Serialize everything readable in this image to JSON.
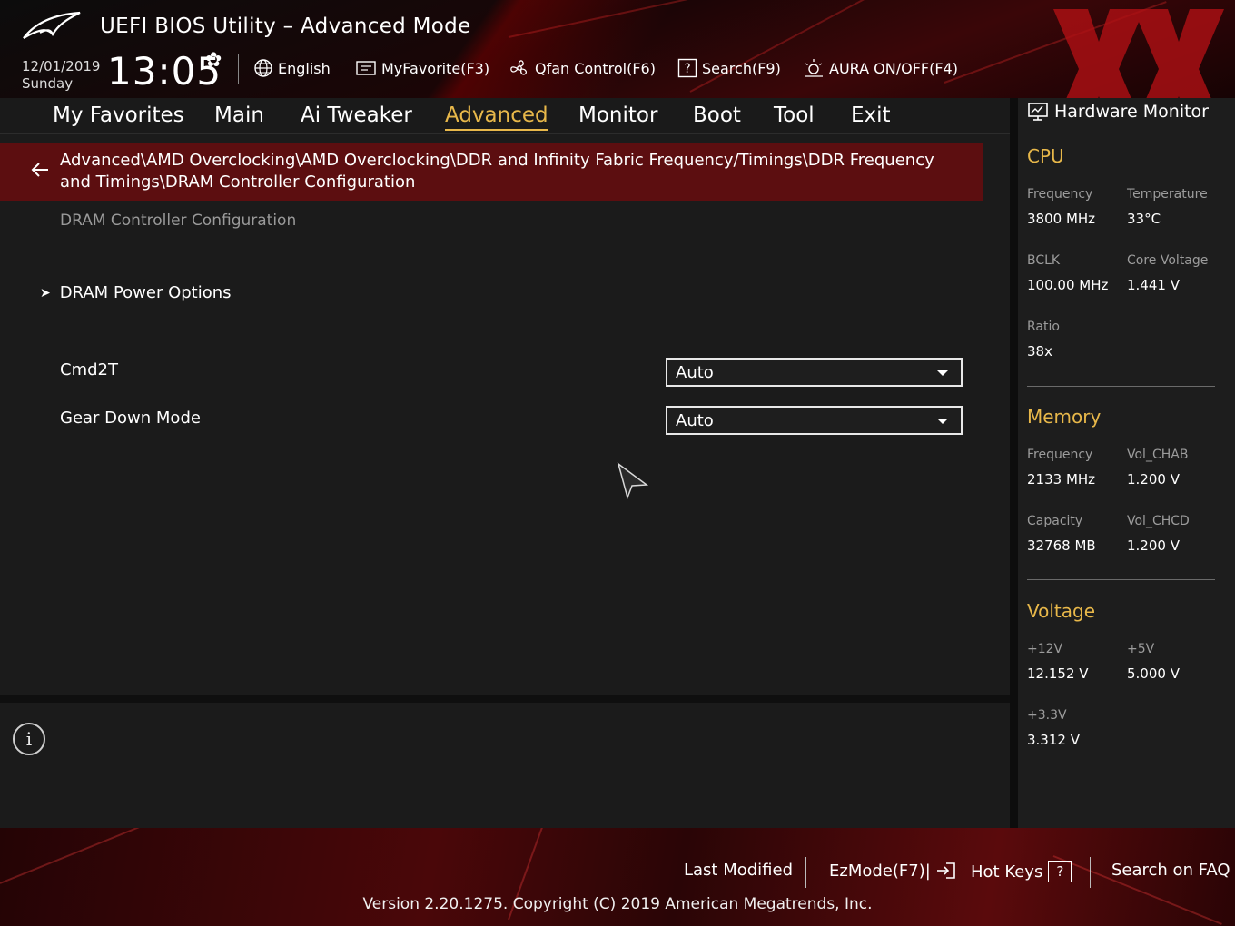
{
  "header": {
    "title": "UEFI BIOS Utility – Advanced Mode",
    "date": "12/01/2019",
    "day": "Sunday",
    "time": "13:05",
    "toolbar": {
      "language": "English",
      "myfavorite": "MyFavorite(F3)",
      "qfan": "Qfan Control(F6)",
      "search": "Search(F9)",
      "aura": "AURA ON/OFF(F4)"
    }
  },
  "nav": {
    "tabs": [
      "My Favorites",
      "Main",
      "Ai Tweaker",
      "Advanced",
      "Monitor",
      "Boot",
      "Tool",
      "Exit"
    ],
    "active": "Advanced"
  },
  "main": {
    "breadcrumb": "Advanced\\AMD Overclocking\\AMD Overclocking\\DDR and Infinity Fabric Frequency/Timings\\DDR Frequency and Timings\\DRAM Controller Configuration",
    "section_title": "DRAM Controller Configuration",
    "submenu": "DRAM Power Options",
    "settings": [
      {
        "label": "Cmd2T",
        "value": "Auto"
      },
      {
        "label": "Gear Down Mode",
        "value": "Auto"
      }
    ]
  },
  "hardware_monitor": {
    "title": "Hardware Monitor",
    "cpu": {
      "heading": "CPU",
      "frequency_label": "Frequency",
      "frequency": "3800 MHz",
      "temperature_label": "Temperature",
      "temperature": "33°C",
      "bclk_label": "BCLK",
      "bclk": "100.00 MHz",
      "core_voltage_label": "Core Voltage",
      "core_voltage": "1.441 V",
      "ratio_label": "Ratio",
      "ratio": "38x"
    },
    "memory": {
      "heading": "Memory",
      "frequency_label": "Frequency",
      "frequency": "2133 MHz",
      "vol_chab_label": "Vol_CHAB",
      "vol_chab": "1.200 V",
      "capacity_label": "Capacity",
      "capacity": "32768 MB",
      "vol_chcd_label": "Vol_CHCD",
      "vol_chcd": "1.200 V"
    },
    "voltage": {
      "heading": "Voltage",
      "v12_label": "+12V",
      "v12": "12.152 V",
      "v5_label": "+5V",
      "v5": "5.000 V",
      "v33_label": "+3.3V",
      "v33": "3.312 V"
    }
  },
  "footer": {
    "last_modified": "Last Modified",
    "ezmode": "EzMode(F7)|",
    "hotkeys": "Hot Keys",
    "hotkeys_key": "?",
    "faq": "Search on FAQ",
    "version": "Version 2.20.1275. Copyright (C) 2019 American Megatrends, Inc."
  },
  "colors": {
    "accent": "#e8b84a",
    "breadcrumb_bg": "#5c0e10",
    "brand_red": "#b01014"
  },
  "icons": [
    "rog-logo-icon",
    "gear-icon",
    "globe-icon",
    "myfavorite-icon",
    "fan-icon",
    "search-help-icon",
    "aura-icon",
    "back-arrow-icon",
    "chevron-right-icon",
    "dropdown-caret-icon",
    "mouse-cursor-icon",
    "info-icon",
    "monitor-icon",
    "exit-ezmode-icon",
    "help-key-icon"
  ]
}
